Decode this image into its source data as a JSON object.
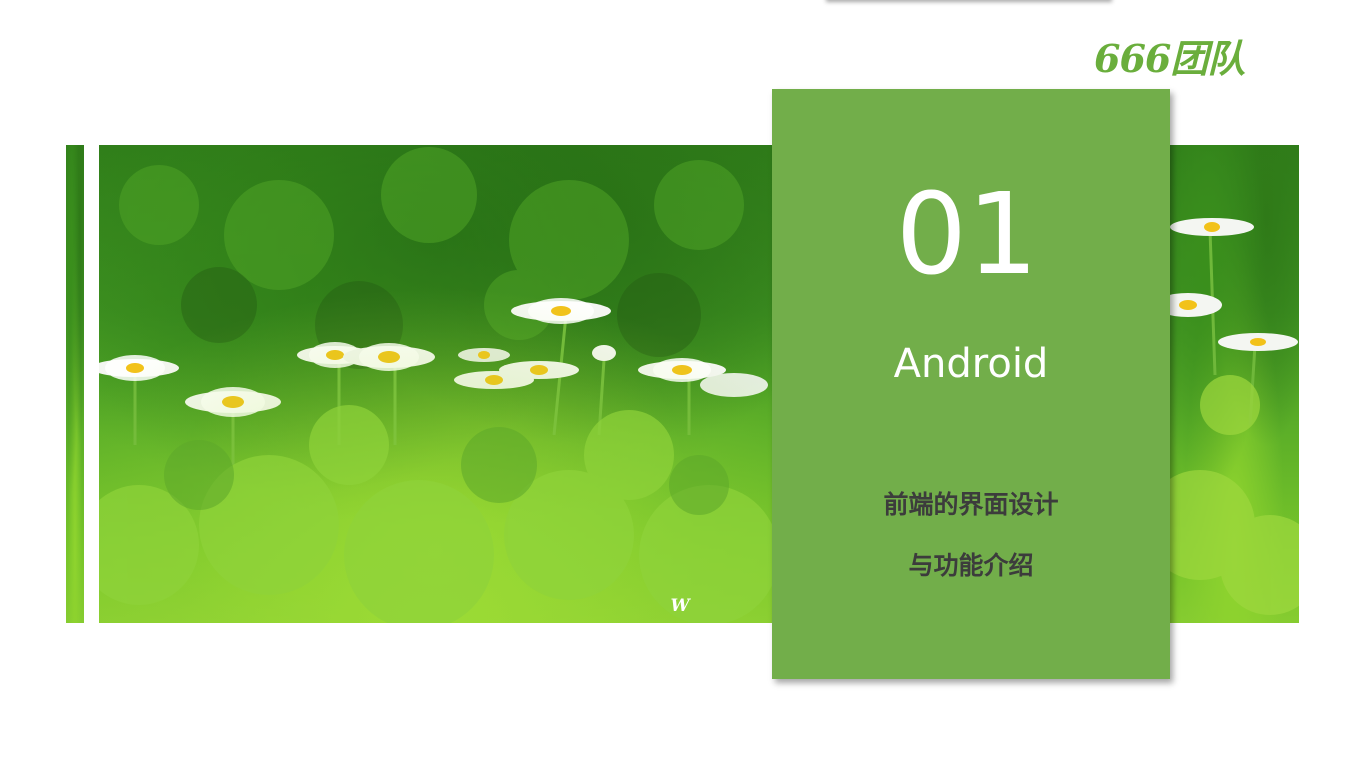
{
  "logo": {
    "text": "666团队"
  },
  "photo": {
    "subject": "white daisies in green foliage",
    "watermark": "W"
  },
  "section": {
    "number": "01",
    "title": "Android",
    "subtitle_line1": "前端的界面设计",
    "subtitle_line2": "与功能介绍"
  },
  "colors": {
    "card_green": "#72ae4a",
    "logo_green": "#6aae3c",
    "subtitle_text": "#3c3c3c",
    "background": "#ffffff"
  }
}
